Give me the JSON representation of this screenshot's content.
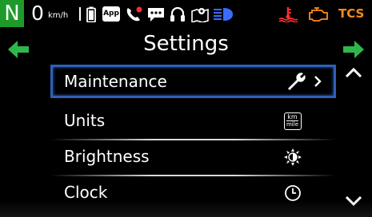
{
  "status": {
    "gear": "N",
    "speed": "0",
    "speed_unit": "km/h",
    "app_badge": "App",
    "tcs_label": "TCS",
    "icons": [
      "battery-icon",
      "app-icon",
      "phone-icon",
      "message-icon",
      "headset-icon",
      "navigation-icon",
      "headlight-icon",
      "coolant-temp-icon",
      "engine-check-icon"
    ]
  },
  "title": "Settings",
  "menu": {
    "items": [
      {
        "label": "Maintenance",
        "icon": "wrench-icon",
        "selected": true,
        "has_chevron": true
      },
      {
        "label": "Units",
        "icon": "km-mile-icon",
        "icon_text_top": "km",
        "icon_text_bottom": "mile"
      },
      {
        "label": "Brightness",
        "icon": "brightness-icon"
      },
      {
        "label": "Clock",
        "icon": "clock-icon"
      }
    ]
  },
  "colors": {
    "gear_bg": "#1d9a2a",
    "nav_arrow": "#2fb84a",
    "selection_border": "#2f5fb8",
    "battery": "#ffffff",
    "phone": "#ff2e2e",
    "headlight": "#3a6cff",
    "warning_red": "#ff2e2e",
    "warning_orange": "#ff8c1a"
  }
}
